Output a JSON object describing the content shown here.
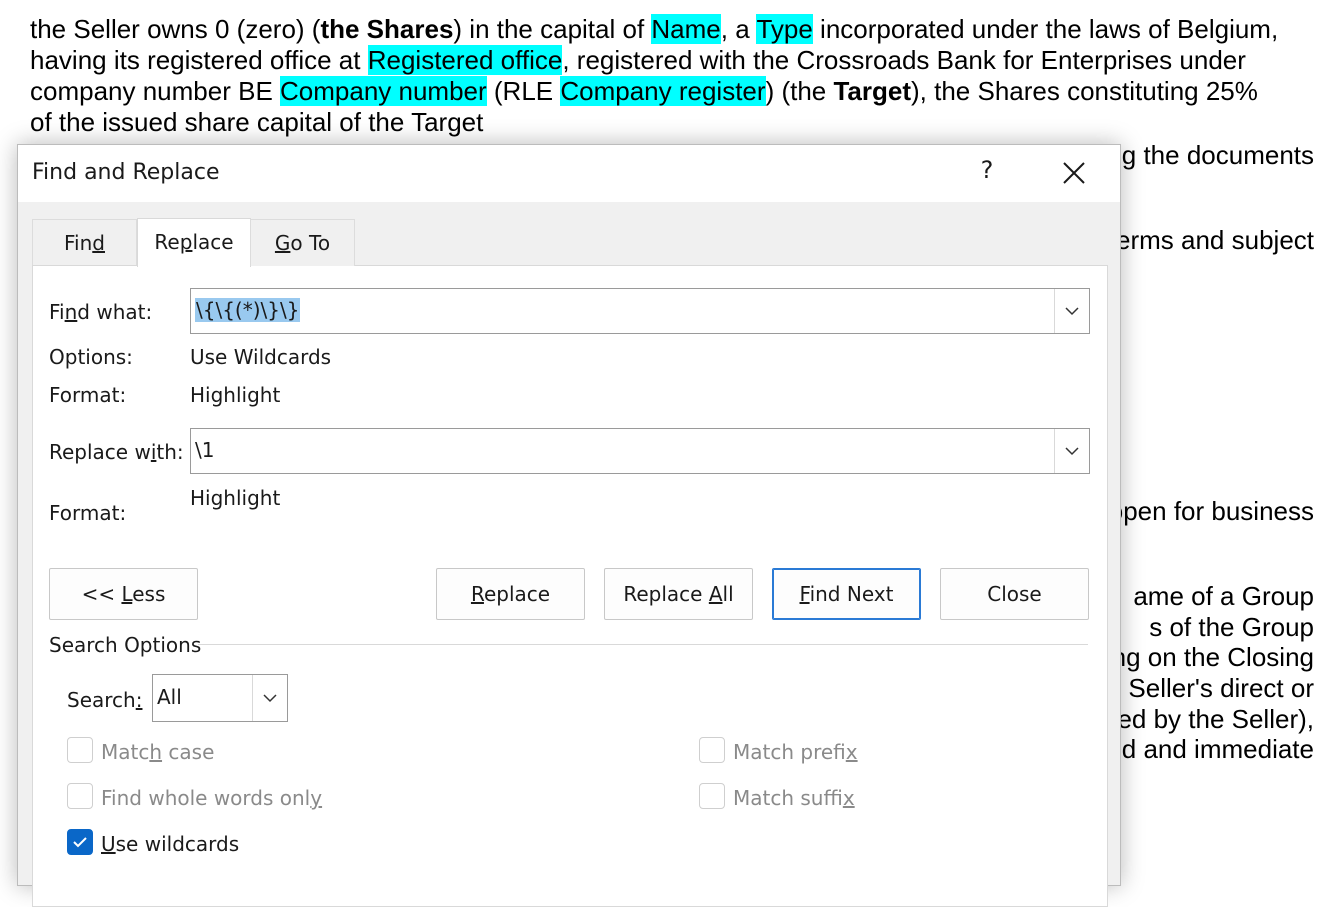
{
  "document": {
    "line1": [
      "the Seller owns 0 (zero) (",
      "the Shares",
      ") in the capital of ",
      "Name",
      ", a ",
      "Type",
      " incorporated under the laws of Belgium,"
    ],
    "line2": [
      "having its registered office at ",
      "Registered office",
      ", registered with the Crossroads Bank for Enterprises under"
    ],
    "line3": [
      "company number BE ",
      "Company number",
      " (RLE ",
      "Company register",
      ") (the ",
      "Target",
      "), the Shares constituting 25%"
    ],
    "line4": "of the issued share capital of the Target",
    "right_fragments": [
      "g the documents",
      "erms and subject",
      "open for business",
      "ame of a Group",
      "s of the Group",
      "ng on the Closing",
      "Seller's direct or",
      "ed by the Seller),",
      "d and immediate"
    ],
    "highlight_color": "#00ffff"
  },
  "dialog": {
    "title": "Find and Replace",
    "help": "?",
    "tabs": [
      {
        "label": "Find",
        "pre": "Fin",
        "u": "d",
        "post": ""
      },
      {
        "label": "Replace",
        "pre": "Re",
        "u": "p",
        "post": "lace"
      },
      {
        "label": "Go To",
        "pre": "",
        "u": "G",
        "post": "o To"
      }
    ],
    "active_tab": "Replace",
    "find_what": {
      "pre": "Fi",
      "u": "n",
      "post": "d what:",
      "value": "\\{\\{(*)\\}\\}"
    },
    "options": {
      "label": "Options:",
      "value": "Use Wildcards"
    },
    "find_format": {
      "label": "Format:",
      "value": "Highlight"
    },
    "replace_with": {
      "pre": "Replace w",
      "u": "i",
      "post": "th:",
      "value": "\\1"
    },
    "replace_format": {
      "label": "Format:",
      "value": "Highlight"
    },
    "buttons": {
      "less": {
        "pre": "<< ",
        "u": "L",
        "post": "ess"
      },
      "replace": {
        "pre": "",
        "u": "R",
        "post": "eplace"
      },
      "replace_all": {
        "pre": "Replace ",
        "u": "A",
        "post": "ll"
      },
      "find_next": {
        "pre": "",
        "u": "F",
        "post": "ind Next"
      },
      "close": "Close"
    },
    "search_options": {
      "heading": "Search Options",
      "search_label_pre": "Search",
      "search_label_u": ":",
      "search_value": "All",
      "match_case": {
        "pre": "Matc",
        "u": "h",
        "post": " case",
        "checked": false
      },
      "whole_words": {
        "pre": "Find whole words onl",
        "u": "y",
        "post": "",
        "checked": false
      },
      "wildcards": {
        "pre": "",
        "u": "U",
        "post": "se wildcards",
        "checked": true
      },
      "match_prefix": {
        "pre": "Match prefi",
        "u": "x",
        "post": "",
        "checked": false
      },
      "match_suffix": {
        "pre": "Match suffi",
        "u": "x",
        "post": "",
        "checked": false
      }
    },
    "accent_color": "#0a67c8"
  }
}
